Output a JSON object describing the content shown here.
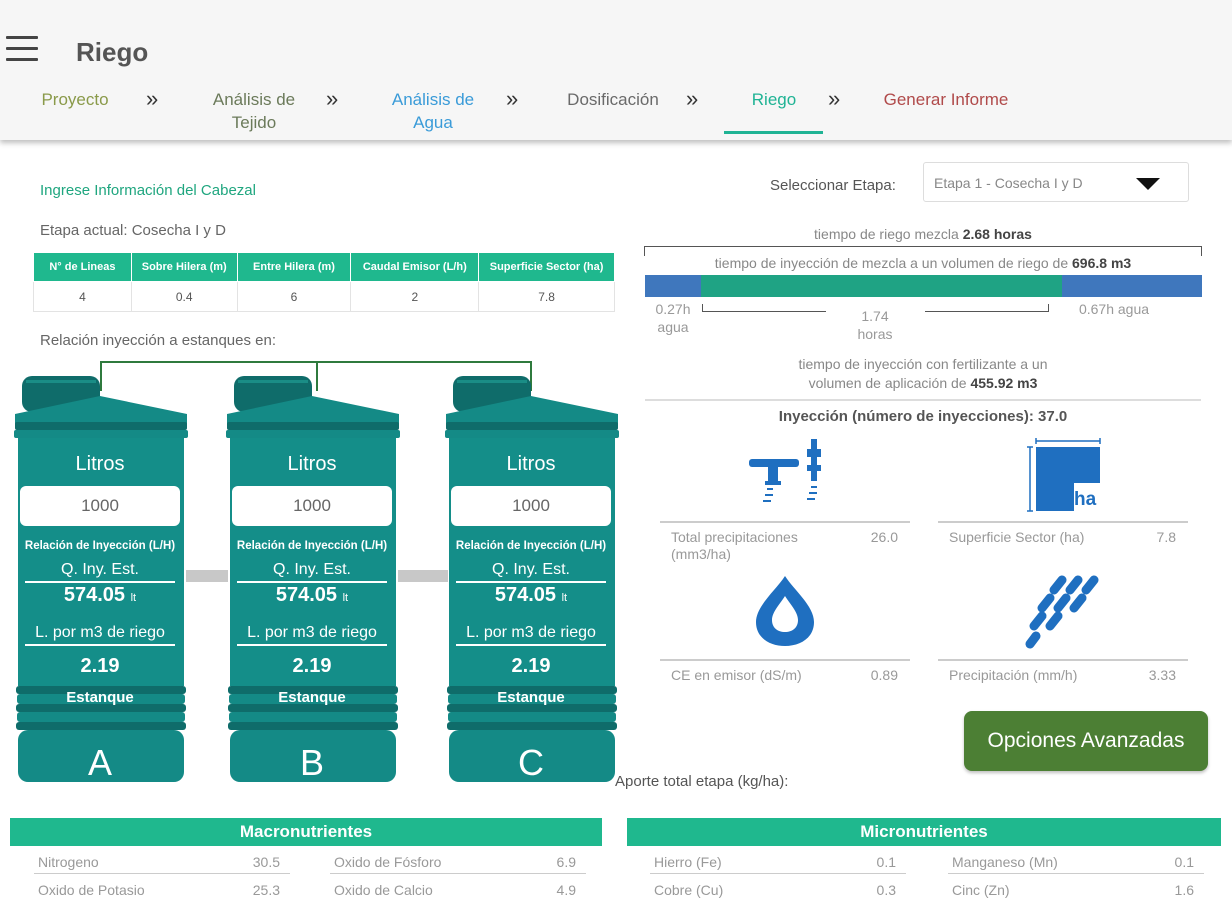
{
  "header": {
    "title": "Riego",
    "steps": [
      {
        "line1": "Proyecto",
        "line2": "",
        "color": "#8a9a4a"
      },
      {
        "line1": "Análisis de",
        "line2": "Tejido",
        "color": "#6b7a5a"
      },
      {
        "line1": "Análisis de",
        "line2": "Agua",
        "color": "#3a9bd8"
      },
      {
        "line1": "Dosificación",
        "line2": "",
        "color": "#6a6a6a"
      },
      {
        "line1": "Riego",
        "line2": "",
        "color": "#1fb394"
      },
      {
        "line1": "Generar Informe",
        "line2": "",
        "color": "#b04a4a"
      }
    ],
    "separator": "»"
  },
  "cabezal": {
    "section_title": "Ingrese Información del Cabezal",
    "stage_label": "Etapa actual: Cosecha I y D",
    "table": {
      "headers": [
        "N° de Lineas",
        "Sobre Hilera (m)",
        "Entre Hilera (m)",
        "Caudal Emisor (L/h)",
        "Superficie Sector (ha)"
      ],
      "values": [
        "4",
        "0.4",
        "6",
        "2",
        "7.8"
      ]
    },
    "relation_label": "Relación inyección a estanques en:"
  },
  "tanks": [
    {
      "litros_label": "Litros",
      "litros_value": "1000",
      "rel_label": "Relación de Inyección (L/H)",
      "q_label": "Q. Iny. Est.",
      "q_value": "574.05",
      "q_unit": "lt",
      "l_label": "L. por m3 de riego",
      "l_value": "2.19",
      "est_label": "Estanque",
      "letter": "A"
    },
    {
      "litros_label": "Litros",
      "litros_value": "1000",
      "rel_label": "Relación de Inyección (L/H)",
      "q_label": "Q. Iny. Est.",
      "q_value": "574.05",
      "q_unit": "lt",
      "l_label": "L. por m3 de riego",
      "l_value": "2.19",
      "est_label": "Estanque",
      "letter": "B"
    },
    {
      "litros_label": "Litros",
      "litros_value": "1000",
      "rel_label": "Relación de Inyección (L/H)",
      "q_label": "Q. Iny. Est.",
      "q_value": "574.05",
      "q_unit": "lt",
      "l_label": "L. por m3 de riego",
      "l_value": "2.19",
      "est_label": "Estanque",
      "letter": "C"
    }
  ],
  "stage_select": {
    "label": "Seleccionar Etapa:",
    "value": "Etapa 1 - Cosecha I y D"
  },
  "timing": {
    "mix_time_text": "tiempo de riego mezcla ",
    "mix_time_value": "2.68 horas",
    "inj_mix_text": "tiempo de inyección de mezcla a un volumen de riego de ",
    "inj_mix_value": "696.8 m3",
    "water_before": "0.27h",
    "water_before_unit": "agua",
    "inj_hours": "1.74",
    "inj_hours_unit": "horas",
    "water_after": "0.67h agua",
    "fert_text_1": "tiempo de inyección con fertilizante a un",
    "fert_text_2": "volumen de aplicación de ",
    "fert_value": "455.92 m3",
    "colors": {
      "water": "#3f77bd",
      "injection": "#1fa384"
    }
  },
  "injection": {
    "title": "Inyección (número de inyecciones): 37.0",
    "stats": [
      {
        "label_1": "Total precipitaciones",
        "label_2": "(mm3/ha)",
        "value": "26.0",
        "icon": "sprinkler-icon"
      },
      {
        "label_1": "Superficie Sector (ha)",
        "label_2": "",
        "value": "7.8",
        "icon": "area-ha-icon"
      },
      {
        "label_1": "CE en emisor (dS/m)",
        "label_2": "",
        "value": "0.89",
        "icon": "water-drop-icon"
      },
      {
        "label_1": "Precipitación (mm/h)",
        "label_2": "",
        "value": "3.33",
        "icon": "rain-icon"
      }
    ],
    "icon_ha_text": "ha",
    "icon_color": "#1f6fc0"
  },
  "advanced_button": "Opciones Avanzadas",
  "aporte_label": "Aporte total etapa (kg/ha):",
  "macronutrientes": {
    "title": "Macronutrientes",
    "items": [
      {
        "name": "Nitrogeno",
        "value": "30.5"
      },
      {
        "name": "Oxido de Fósforo",
        "value": "6.9"
      },
      {
        "name": "Oxido de Potasio",
        "value": "25.3"
      },
      {
        "name": "Oxido de Calcio",
        "value": "4.9"
      }
    ]
  },
  "micronutrientes": {
    "title": "Micronutrientes",
    "items": [
      {
        "name": "Hierro (Fe)",
        "value": "0.1"
      },
      {
        "name": "Manganeso (Mn)",
        "value": "0.1"
      },
      {
        "name": "Cobre (Cu)",
        "value": "0.3"
      },
      {
        "name": "Cinc (Zn)",
        "value": "1.6"
      }
    ]
  }
}
